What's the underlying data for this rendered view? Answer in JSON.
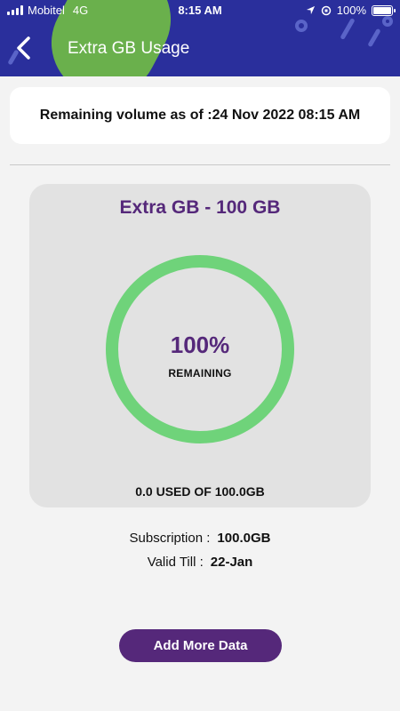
{
  "status_bar": {
    "carrier": "Mobitel",
    "network": "4G",
    "time": "8:15 AM",
    "battery": "100%"
  },
  "header": {
    "title": "Extra GB Usage",
    "back_icon": "chevron-left-icon"
  },
  "remaining_as_of": "Remaining volume as of :24 Nov 2022 08:15 AM",
  "package": {
    "title": "Extra GB - 100 GB",
    "remaining_percent": "100%",
    "remaining_label": "REMAINING",
    "remaining_fraction": 1.0,
    "used_text": "0.0 USED OF 100.0GB"
  },
  "details": {
    "subscription_label": "Subscription :",
    "subscription_value": "100.0GB",
    "valid_till_label": "Valid Till :",
    "valid_till_value": "22-Jan"
  },
  "actions": {
    "add_more_label": "Add More Data"
  },
  "colors": {
    "header_bg": "#2a2f9c",
    "accent_purple": "#55287a",
    "ring_green": "#6fd37a"
  }
}
